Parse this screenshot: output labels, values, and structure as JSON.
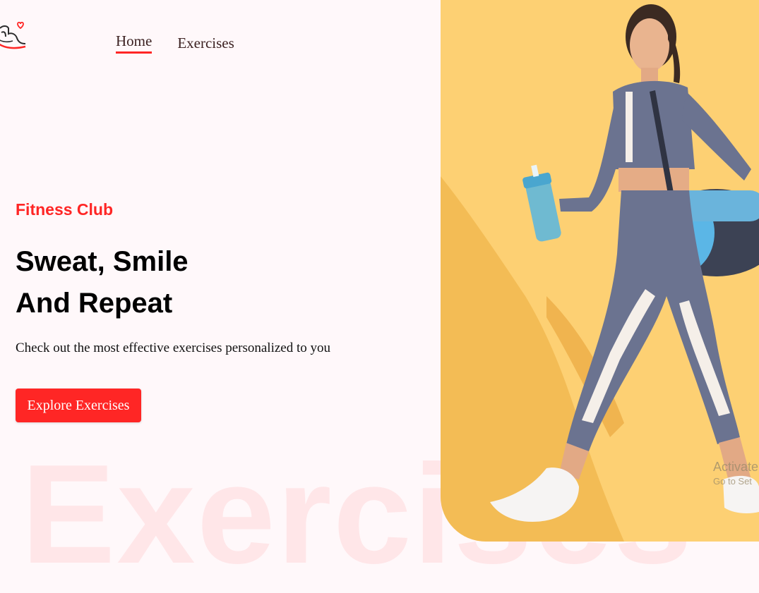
{
  "nav": {
    "items": [
      {
        "label": "Home",
        "active": true
      },
      {
        "label": "Exercises",
        "active": false
      }
    ]
  },
  "hero": {
    "tag": "Fitness Club",
    "title_line1": "Sweat, Smile",
    "title_line2": "And Repeat",
    "subtitle": "Check out the most effective exercises personalized to you",
    "cta_label": "Explore Exercises",
    "background_word": "Exercises",
    "image_icon": "woman-walking-with-gym-bag-photo"
  },
  "watermark": {
    "line1": "Activate",
    "line2": "Go to Set"
  },
  "colors": {
    "accent": "#ff2625",
    "background": "#fff8fa",
    "image_background": "#fdd073"
  }
}
